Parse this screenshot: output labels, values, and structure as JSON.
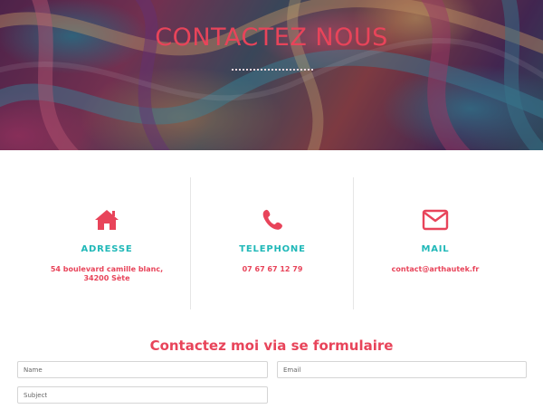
{
  "hero": {
    "title": "CONTACTEZ NOUS"
  },
  "contact_info": [
    {
      "icon": "home-icon",
      "title": "ADRESSE",
      "lines": [
        "54 boulevard camille blanc,",
        "34200 Sète"
      ]
    },
    {
      "icon": "phone-icon",
      "title": "TELEPHONE",
      "lines": [
        "07 67 67 12 79"
      ]
    },
    {
      "icon": "mail-icon",
      "title": "MAIL",
      "lines": [
        "contact@arthautek.fr"
      ]
    }
  ],
  "form": {
    "title": "Contactez moi via se formulaire",
    "name_placeholder": "Name",
    "email_placeholder": "Email",
    "subject_placeholder": "Subject"
  },
  "colors": {
    "accent": "#e8445a",
    "teal": "#20b8b8",
    "divider": "#e6e6e6"
  }
}
